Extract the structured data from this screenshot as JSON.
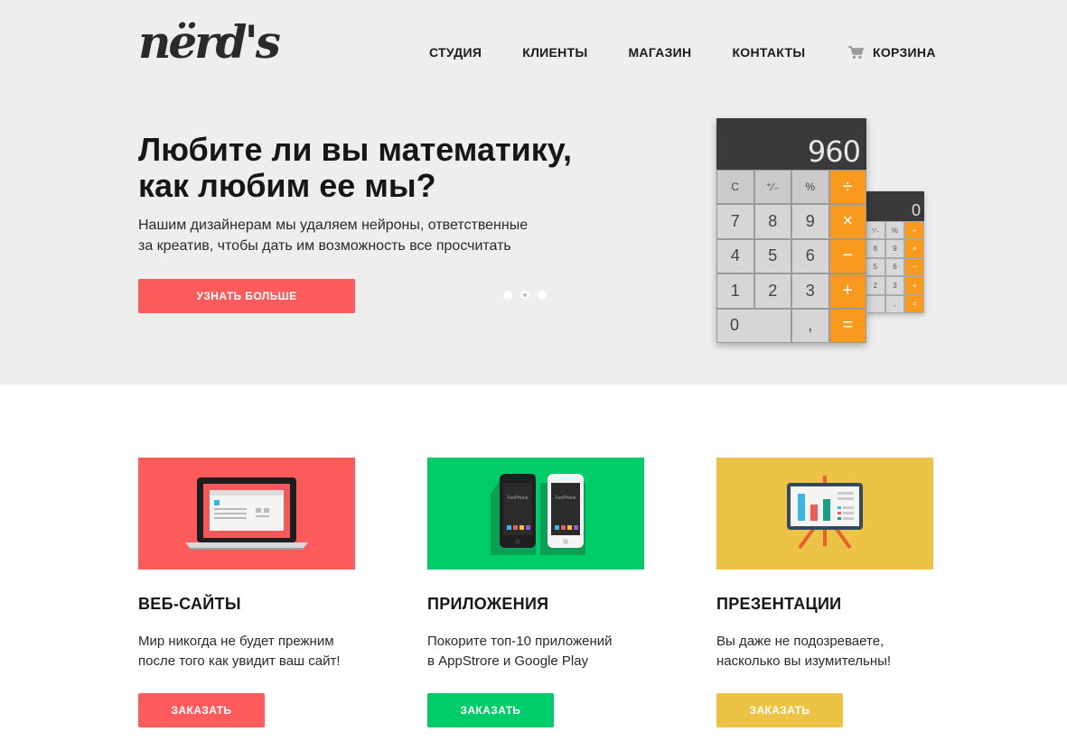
{
  "logo": {
    "text": "nërd's"
  },
  "nav": {
    "items": [
      {
        "label": "СТУДИЯ"
      },
      {
        "label": "КЛИЕНТЫ"
      },
      {
        "label": "МАГАЗИН"
      },
      {
        "label": "КОНТАКТЫ"
      }
    ],
    "cart_label": "КОРЗИНА",
    "cart_icon": "cart-icon"
  },
  "hero": {
    "title": "Любите ли вы математику,\nкак любим ее мы?",
    "text": "Нашим дизайнерам мы удаляем нейроны, ответственные\nза креатив, чтобы дать им возможность все просчитать",
    "button_label": "УЗНАТЬ БОЛЬШЕ",
    "slides": 3,
    "active_slide": 2,
    "calc_big": {
      "display": "960",
      "keys": [
        "C",
        "⁺∕₋",
        "%",
        "÷",
        "7",
        "8",
        "9",
        "×",
        "4",
        "5",
        "6",
        "−",
        "1",
        "2",
        "3",
        "+",
        "0",
        ",",
        "="
      ]
    },
    "calc_small": {
      "display": "0",
      "keys": [
        "⁺∕₋",
        "%",
        "÷",
        "8",
        "9",
        "×",
        "5",
        "6",
        "−",
        "2",
        "3",
        "+",
        "",
        ",",
        "="
      ]
    }
  },
  "services": [
    {
      "title": "ВЕБ-САЙТЫ",
      "text": "Мир никогда не будет прежним\nпосле того как увидит ваш сайт!",
      "button_label": "ЗАКАЗАТЬ",
      "color": "#fe5c5c",
      "icon": "laptop-icon"
    },
    {
      "title": "ПРИЛОЖЕНИЯ",
      "text": "Покорите топ-10 приложений\nв AppStrore и Google Play",
      "button_label": "ЗАКАЗАТЬ",
      "color": "#00cc6a",
      "icon": "phones-icon",
      "phone_label": "FunPhone"
    },
    {
      "title": "ПРЕЗЕНТАЦИИ",
      "text": "Вы даже не подозреваете,\nнасколько вы изумительны!",
      "button_label": "ЗАКАЗАТЬ",
      "color": "#ecc345",
      "icon": "presentation-board-icon"
    }
  ],
  "colors": {
    "hero_bg": "#eeeeee",
    "accent_red": "#fe5c5c",
    "accent_green": "#00cc6a",
    "accent_yellow": "#ecc345",
    "calc_orange": "#f89a1e"
  }
}
